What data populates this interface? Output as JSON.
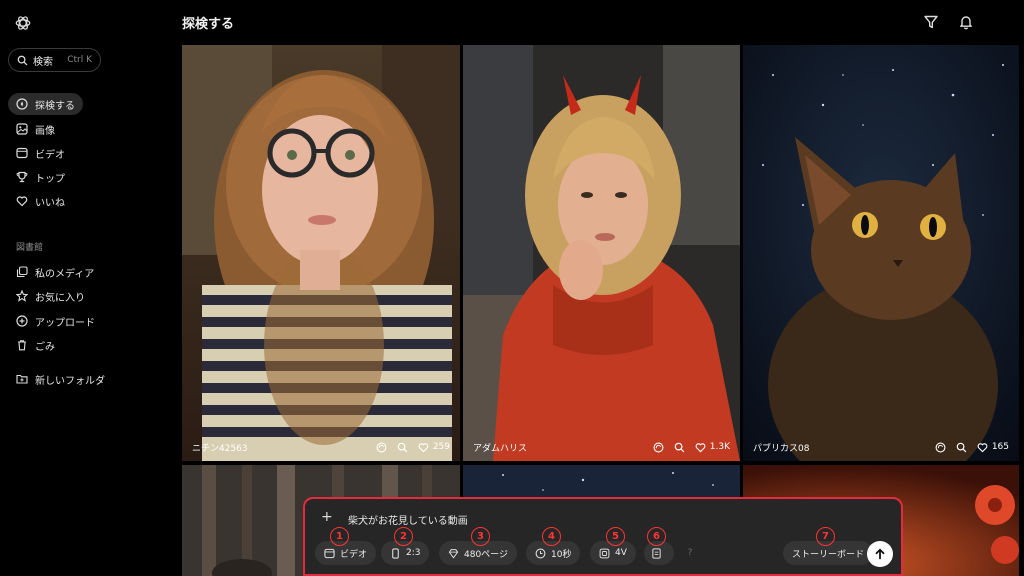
{
  "sidebar": {
    "search": {
      "label": "検索",
      "shortcut": "Ctrl K"
    },
    "nav": [
      {
        "label": "探検する",
        "icon": "compass-icon"
      },
      {
        "label": "画像",
        "icon": "image-icon"
      },
      {
        "label": "ビデオ",
        "icon": "video-icon"
      },
      {
        "label": "トップ",
        "icon": "trophy-icon"
      },
      {
        "label": "いいね",
        "icon": "heart-icon"
      }
    ],
    "library_label": "図書館",
    "library": [
      {
        "label": "私のメディア",
        "icon": "media-icon"
      },
      {
        "label": "お気に入り",
        "icon": "star-icon"
      },
      {
        "label": "アップロード",
        "icon": "upload-icon"
      },
      {
        "label": "ごみ",
        "icon": "trash-icon"
      }
    ],
    "new_folder": "新しいフォルダ"
  },
  "header": {
    "title": "探検する"
  },
  "cards": [
    {
      "author": "ニチン42563",
      "likes": "259"
    },
    {
      "author": "アダムハリス",
      "likes": "1.3K"
    },
    {
      "author": "パブリカス08",
      "likes": "165"
    }
  ],
  "prompt": {
    "text": "柴犬がお花見している動画",
    "chips": [
      {
        "label": "ビデオ",
        "icon": "video-icon",
        "badge": "1"
      },
      {
        "label": "2:3",
        "icon": "aspect-ratio-icon",
        "badge": "2"
      },
      {
        "label": "480ページ",
        "icon": "quality-icon",
        "badge": "3"
      },
      {
        "label": "10秒",
        "icon": "clock-icon",
        "badge": "4"
      },
      {
        "label": "4V",
        "icon": "variations-icon",
        "badge": "5"
      },
      {
        "label": "",
        "icon": "preset-icon",
        "badge": "6"
      },
      {
        "label": "?",
        "icon": "help-icon",
        "badge": ""
      },
      {
        "label": "ストーリーボード",
        "icon": "",
        "badge": "7"
      }
    ]
  },
  "colors": {
    "highlight": "#e32b3d",
    "active_nav": "#2b2b2b",
    "chip_bg": "#353535"
  }
}
